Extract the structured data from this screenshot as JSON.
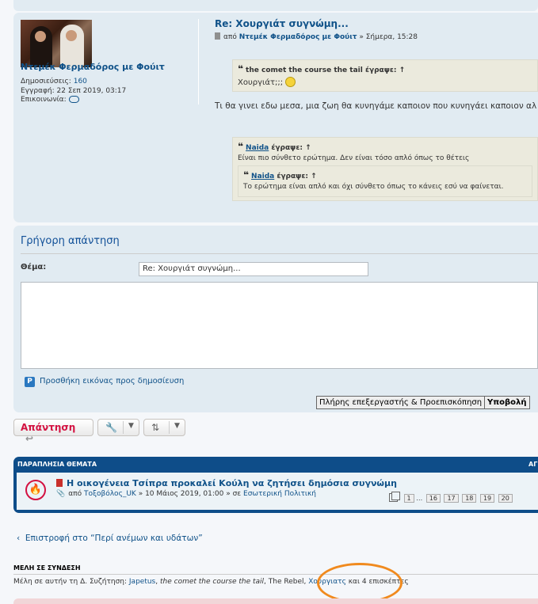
{
  "post": {
    "author": "Ντεμέκ Φερμαδόρος με Φούιτ",
    "posts_label": "Δημοσιεύσεις:",
    "posts_count": "160",
    "joined_label": "Εγγραφή:",
    "joined_date": "22 Σεπ 2019, 03:17",
    "contact_label": "Επικοινωνία:",
    "title": "Re: Χουργιάτ συγνώμη...",
    "meta_by": "από",
    "meta_time": "» Σήμερα, 15:28",
    "quote1": {
      "user": "the comet the course the tail",
      "wrote": "έγραψε:",
      "arrow": "↑",
      "text": "Χουργιάτ;;;"
    },
    "body": "Τι θα γινει εδω μεσα, μια ζωη θα κυνηγάμε καποιον που κυνηγάει καποιον αλ",
    "quote2": {
      "user": "Naida",
      "wrote": "έγραψε:",
      "arrow": "↑",
      "text": "Είναι πιο σύνθετο ερώτημα. Δεν είναι τόσο απλό όπως το θέτεις"
    },
    "quote3": {
      "user": "Naida",
      "wrote": "έγραψε:",
      "arrow": "↑",
      "text": "Το ερώτημα είναι απλό και όχι σύνθετο όπως το κάνεις εσύ να φαίνεται."
    }
  },
  "quick_reply": {
    "title": "Γρήγορη απάντηση",
    "subject_label": "Θέμα:",
    "subject_value": "Re: Χουργιάτ συγνώμη...",
    "add_image": "Προσθήκη εικόνας προς δημοσίευση",
    "full_editor": "Πλήρης επεξεργαστής & Προεπισκόπηση",
    "submit": "Υποβολή"
  },
  "actions": {
    "reply": "Απάντηση"
  },
  "similar": {
    "header": "ΠΑΡΑΠΛΗΣΙΑ ΘΕΜΑΤΑ",
    "header_right": "ΑΓ",
    "topic_title": "Η οικογένεια Τσίπρα προκαλεί Κούλη να ζητήσει δημόσια συγνώμη",
    "topic_by": "από",
    "topic_author": "Τοξοβόλος_UK",
    "topic_date": "» 10 Μάιος 2019, 01:00 » σε",
    "topic_forum": "Εσωτερική Πολιτική",
    "pages": [
      "1",
      "…",
      "16",
      "17",
      "18",
      "19",
      "20"
    ]
  },
  "back_link": "Επιστροφή στο “Περί ανέμων και υδάτων”",
  "online": {
    "header": "ΜΕΛΗ ΣΕ ΣΥΝΔΕΣΗ",
    "prefix": "Μέλη σε αυτήν τη Δ. Συζήτηση:",
    "users": [
      "Japetus",
      "the comet the course the tail",
      "The Rebel",
      "Χουργιατς"
    ],
    "suffix": "και 4 επισκέπτες"
  },
  "colors": {
    "accent": "#105289",
    "reply": "#d31141",
    "highlight": "#f08a1e",
    "bar": "#0e4d89"
  },
  "icons": [
    "speech-bubble-icon",
    "document-icon",
    "quote-icon",
    "smiley-icon",
    "p-icon",
    "reply-arrow-icon",
    "wrench-icon",
    "sort-icon",
    "fire-icon",
    "pdf-icon",
    "attachment-icon",
    "pages-icon",
    "chevron-left-icon"
  ]
}
